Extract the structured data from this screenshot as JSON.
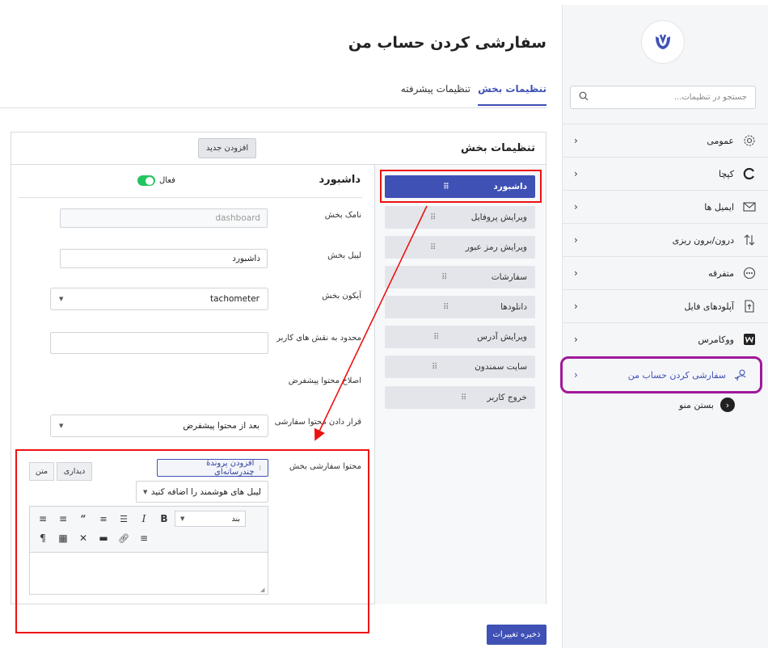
{
  "sidebar": {
    "search_placeholder": "جستجو در تنظیمات...",
    "items": [
      {
        "label": "عمومی",
        "icon": "gear-icon"
      },
      {
        "label": "کپچا",
        "icon": "captcha-icon"
      },
      {
        "label": "ایمیل ها",
        "icon": "mail-icon"
      },
      {
        "label": "درون/برون ریزی",
        "icon": "import-export-icon"
      },
      {
        "label": "متفرقه",
        "icon": "more-icon"
      },
      {
        "label": "آپلودهای فایل",
        "icon": "file-upload-icon"
      },
      {
        "label": "ووکامرس",
        "icon": "woocommerce-icon"
      },
      {
        "label": "سفارشی کردن حساب من",
        "icon": "user-check-icon"
      }
    ],
    "close_label": "بستن منو"
  },
  "header": {
    "title": "سفارشی کردن حساب من",
    "tabs": [
      {
        "label": "تنظیمات بخش"
      },
      {
        "label": "تنظیمات پیشرفته"
      }
    ]
  },
  "panel": {
    "title": "تنظیمات بخش",
    "add_new": "افزودن جدید",
    "sections": [
      {
        "label": "داشبورد"
      },
      {
        "label": "ویرایش پروفایل"
      },
      {
        "label": "ویرایش رمز عبور"
      },
      {
        "label": "سفارشات"
      },
      {
        "label": "دانلودها"
      },
      {
        "label": "ویرایش آدرس"
      },
      {
        "label": "سایت سمندون"
      },
      {
        "label": "خروج کاربر"
      }
    ]
  },
  "form": {
    "title": "داشبورد",
    "active_label": "فعال",
    "name_label": "نامک بخش",
    "name_placeholder": "dashboard",
    "section_label": "لیبل بخش",
    "section_value": "داشبورد",
    "icon_label": "آیکون بخش",
    "icon_value": "tachometer",
    "roles_label": "محدود به نقش های کاربر",
    "roles_value": "",
    "modify_label": "اصلاح محتوا پیشفرض",
    "placement_label": "قرار دادن محتوا سفارشی",
    "placement_value": "بعد از محتوا پیشفرض",
    "content_label": "محتوا سفارشی بخش",
    "add_media": "افزودن پروندهٔ چندرسانه‌ای",
    "visual_tab": "دیداری",
    "text_tab": "متن",
    "smart_label_placeholder": "لیبل های هوشمند را اضافه کنید",
    "paragraph_value": "بند"
  },
  "save_label": "ذخیره تغییرات",
  "colors": {
    "accent": "#3f51b5",
    "toggle_on": "#22c55e",
    "highlight_red": "#e11111",
    "highlight_purple": "#a0189a"
  }
}
